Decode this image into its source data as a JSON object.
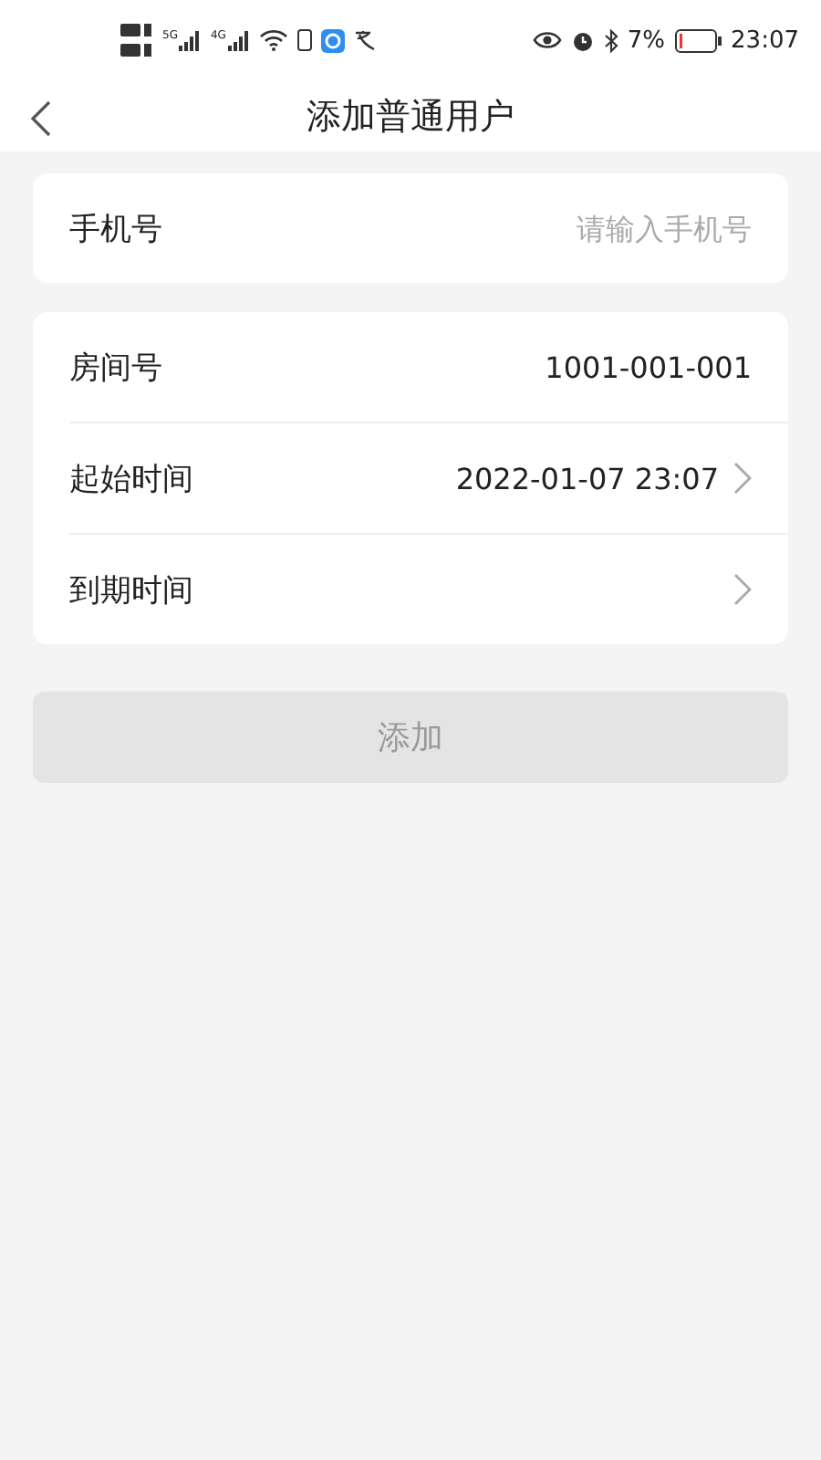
{
  "status_bar": {
    "signals": [
      {
        "label": "5G"
      },
      {
        "label": "4G"
      }
    ],
    "battery_text": "7%",
    "time": "23:07"
  },
  "nav": {
    "title": "添加普通用户"
  },
  "phone": {
    "label": "手机号",
    "placeholder": "请输入手机号"
  },
  "details": [
    {
      "kind": "value",
      "label": "房间号",
      "value": "1001-001-001"
    },
    {
      "kind": "picker",
      "label": "起始时间",
      "value": "2022-01-07 23:07"
    },
    {
      "kind": "picker",
      "label": "到期时间"
    }
  ],
  "submit": {
    "label": "添加",
    "disabled": true
  }
}
